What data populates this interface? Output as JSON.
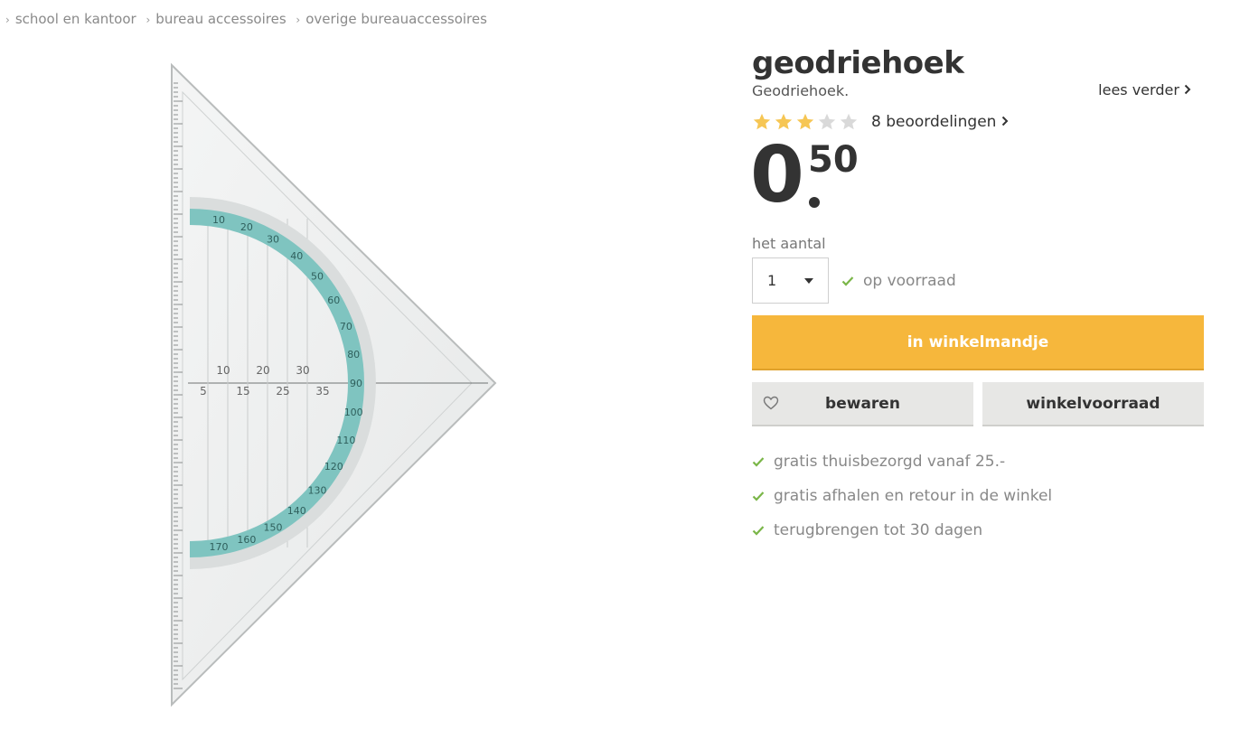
{
  "breadcrumb": {
    "separator": "›",
    "items": [
      "school en kantoor",
      "bureau accessoires",
      "overige bureauaccessoires"
    ]
  },
  "product": {
    "title": "geodriehoek",
    "subtitle": "Geodriehoek.",
    "read_more": "lees verder",
    "rating": {
      "value": 3,
      "max": 5,
      "reviews_label": "8 beoordelingen"
    },
    "price": {
      "whole": "0",
      "cents": "50"
    },
    "quantity": {
      "label": "het aantal",
      "value": "1"
    },
    "stock_status": "op voorraad",
    "cart_button": "in winkelmandje",
    "save_button": "bewaren",
    "store_stock_button": "winkelvoorraad",
    "usps": [
      "gratis thuisbezorgd vanaf 25.-",
      "gratis afhalen en retour in de winkel",
      "terugbrengen tot 30 dagen"
    ]
  },
  "image": {
    "protractor_labels": [
      "10",
      "20",
      "30",
      "40",
      "50",
      "60",
      "70",
      "80",
      "90",
      "100",
      "110",
      "120",
      "130",
      "140",
      "150",
      "160",
      "170"
    ],
    "ruler_labels": [
      "5",
      "10",
      "15",
      "20",
      "25",
      "30",
      "35"
    ]
  },
  "colors": {
    "accent": "#f6b73c",
    "star_filled": "#f6c654",
    "star_empty": "#d9d9d9",
    "check": "#7ab648",
    "protractor_band": "#7fc4c0"
  },
  "icons": {
    "check": "check-icon",
    "heart": "heart-icon",
    "star": "star-icon",
    "chevron": "chevron-right-icon",
    "caret": "caret-down-icon"
  }
}
